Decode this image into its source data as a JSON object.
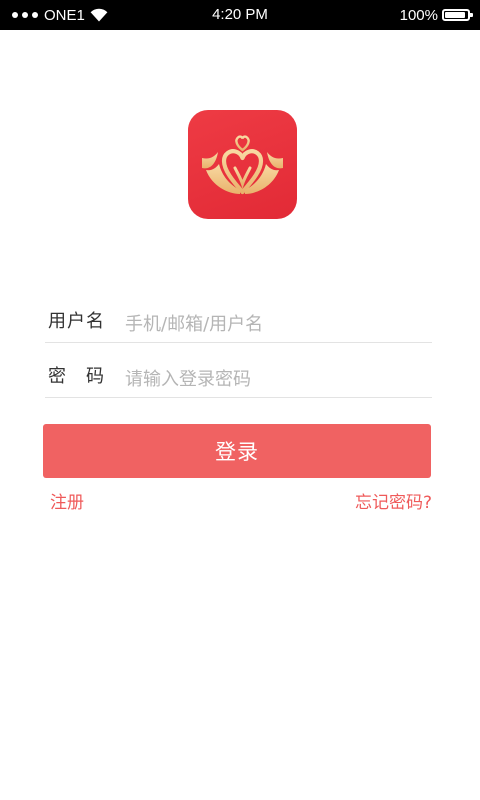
{
  "status_bar": {
    "carrier": "ONE1",
    "time": "4:20 PM",
    "battery": "100%",
    "battery_level": 1.0,
    "signal_icon": "signal-dots-icon",
    "wifi_icon": "wifi-icon",
    "battery_icon": "battery-icon"
  },
  "logo": {
    "icon": "heart-crown-logo",
    "background_color": "#e8313c",
    "emblem_color": "#f3c98b"
  },
  "login_form": {
    "username_label": "用户名",
    "username_placeholder": "手机/邮箱/用户名",
    "username_value": "",
    "password_label": "密　码",
    "password_placeholder": "请输入登录密码",
    "password_value": "",
    "submit_label": "登录"
  },
  "links": {
    "register": "注册",
    "forgot_password": "忘记密码?"
  },
  "colors": {
    "accent": "#f06262",
    "link": "#ef5a5a",
    "status_bar_bg": "#000000"
  }
}
